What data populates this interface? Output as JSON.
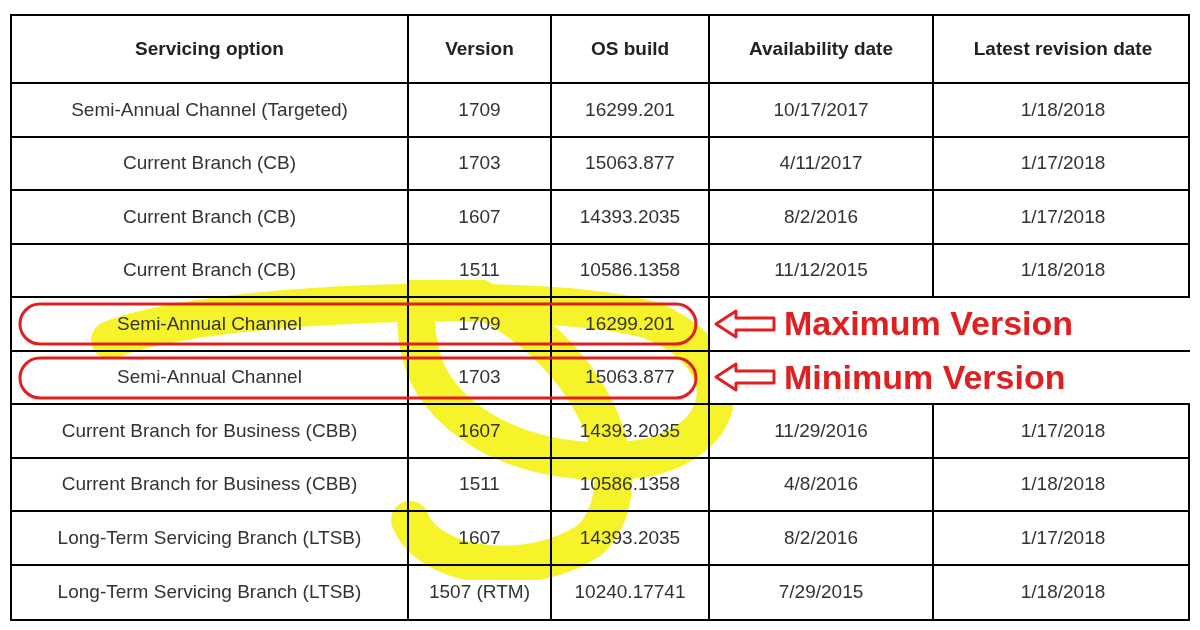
{
  "table": {
    "columns": [
      "Servicing option",
      "Version",
      "OS build",
      "Availability date",
      "Latest revision date"
    ],
    "rows": [
      {
        "cells": [
          "Semi-Annual Channel (Targeted)",
          "1709",
          "16299.201",
          "10/17/2017",
          "1/18/2018"
        ]
      },
      {
        "cells": [
          "Current Branch (CB)",
          "1703",
          "15063.877",
          "4/11/2017",
          "1/17/2018"
        ]
      },
      {
        "cells": [
          "Current Branch (CB)",
          "1607",
          "14393.2035",
          "8/2/2016",
          "1/17/2018"
        ]
      },
      {
        "cells": [
          "Current Branch (CB)",
          "1511",
          "10586.1358",
          "11/12/2015",
          "1/18/2018"
        ]
      },
      {
        "cells": [
          "Semi-Annual Channel",
          "1709",
          "16299.201"
        ],
        "annotation": "Maximum Version"
      },
      {
        "cells": [
          "Semi-Annual Channel",
          "1703",
          "15063.877"
        ],
        "annotation": "Minimum Version"
      },
      {
        "cells": [
          "Current Branch for Business (CBB)",
          "1607",
          "14393.2035",
          "11/29/2016",
          "1/17/2018"
        ]
      },
      {
        "cells": [
          "Current Branch for Business (CBB)",
          "1511",
          "10586.1358",
          "4/8/2016",
          "1/18/2018"
        ]
      },
      {
        "cells": [
          "Long-Term Servicing Branch (LTSB)",
          "1607",
          "14393.2035",
          "8/2/2016",
          "1/17/2018"
        ]
      },
      {
        "cells": [
          "Long-Term Servicing Branch (LTSB)",
          "1507 (RTM)",
          "10240.17741",
          "7/29/2015",
          "1/18/2018"
        ]
      }
    ]
  }
}
